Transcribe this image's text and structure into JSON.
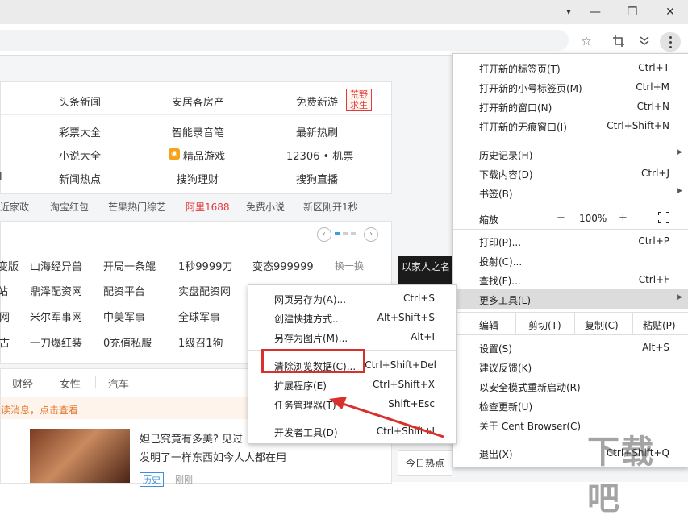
{
  "window": {
    "controls": [
      "▾",
      "—",
      "❐",
      "✕"
    ]
  },
  "toolbar": {
    "icons": [
      "star-icon",
      "crop-icon",
      "download-icon",
      "menu-icon"
    ]
  },
  "page": {
    "nav_rows": [
      [
        "头条新闻",
        "安居客房产",
        "免费新游"
      ],
      [
        "彩票大全",
        "智能录音笔",
        "最新热刷"
      ],
      [
        "小说大全",
        "精品游戏",
        "12306 • 机票"
      ],
      [
        "新闻热点",
        "搜狗理财",
        "搜狗直播"
      ]
    ],
    "row_left_fragment": "l",
    "badge_text": "荒野求生",
    "hot_links": [
      "近家政",
      "淘宝红包",
      "芒果热门综艺",
      "阿里1688",
      "免费小说",
      "新区刚开1秒"
    ],
    "hot_accent": "#e4393c",
    "game_rows": [
      [
        "变版",
        "山海经异兽",
        "开局一条鲲",
        "1秒9999刀",
        "变态999999"
      ],
      [
        "站",
        "鼎泽配资网",
        "配资平台",
        "实盘配资网"
      ],
      [
        "网",
        "米尔军事网",
        "中美军事",
        "全球军事"
      ],
      [
        "古",
        "一刀爆红装",
        "0充值私服",
        "1级召1狗"
      ]
    ],
    "refresh_label": "换一换",
    "category_tabs": [
      "财经",
      "女性",
      "汽车"
    ],
    "notice": "读消息，点击查看",
    "news_title_1": "妲己究竟有多美? 见过",
    "news_title_2": "发明了一样东西如今人人都在用",
    "news_tag": "历史",
    "news_time": "刚刚",
    "side_button": "今日热点",
    "side_banner": "以家人之名"
  },
  "main_menu": {
    "groups": [
      [
        {
          "label": "打开新的标签页(T)",
          "shortcut": "Ctrl+T"
        },
        {
          "label": "打开新的小号标签页(M)",
          "shortcut": "Ctrl+M"
        },
        {
          "label": "打开新的窗口(N)",
          "shortcut": "Ctrl+N"
        },
        {
          "label": "打开新的无痕窗口(I)",
          "shortcut": "Ctrl+Shift+N"
        }
      ],
      [
        {
          "label": "历史记录(H)",
          "shortcut": "",
          "arrow": true
        },
        {
          "label": "下载内容(D)",
          "shortcut": "Ctrl+J"
        },
        {
          "label": "书签(B)",
          "shortcut": "",
          "arrow": true
        }
      ]
    ],
    "zoom": {
      "label": "缩放",
      "minus": "−",
      "value": "100%",
      "plus": "+"
    },
    "groups2": [
      [
        {
          "label": "打印(P)...",
          "shortcut": "Ctrl+P"
        },
        {
          "label": "投射(C)...",
          "shortcut": ""
        },
        {
          "label": "查找(F)...",
          "shortcut": "Ctrl+F"
        },
        {
          "label": "更多工具(L)",
          "shortcut": "",
          "arrow": true
        }
      ]
    ],
    "edit": {
      "label": "编辑",
      "cut": "剪切(T)",
      "copy": "复制(C)",
      "paste": "粘贴(P)"
    },
    "groups3": [
      [
        {
          "label": "设置(S)",
          "shortcut": "Alt+S"
        },
        {
          "label": "建议反馈(K)",
          "shortcut": ""
        },
        {
          "label": "以安全模式重新启动(R)",
          "shortcut": ""
        },
        {
          "label": "检查更新(U)",
          "shortcut": ""
        },
        {
          "label": "关于 Cent Browser(C)",
          "shortcut": ""
        }
      ]
    ],
    "exit": {
      "label": "退出(X)",
      "shortcut": "Ctrl+Shift+Q"
    }
  },
  "sub_menu": {
    "items": [
      {
        "label": "网页另存为(A)...",
        "shortcut": "Ctrl+S"
      },
      {
        "label": "创建快捷方式...",
        "shortcut": "Alt+Shift+S"
      },
      {
        "label": "另存为图片(M)...",
        "shortcut": "Alt+I"
      },
      {
        "label": "清除浏览数据(C)...",
        "shortcut": "Ctrl+Shift+Del"
      },
      {
        "label": "扩展程序(E)",
        "shortcut": "Ctrl+Shift+X"
      },
      {
        "label": "任务管理器(T)",
        "shortcut": "Shift+Esc"
      },
      {
        "label": "开发者工具(D)",
        "shortcut": "Ctrl+Shift+I"
      }
    ]
  },
  "watermark": "下载吧",
  "highlight_color": "#d9302c"
}
